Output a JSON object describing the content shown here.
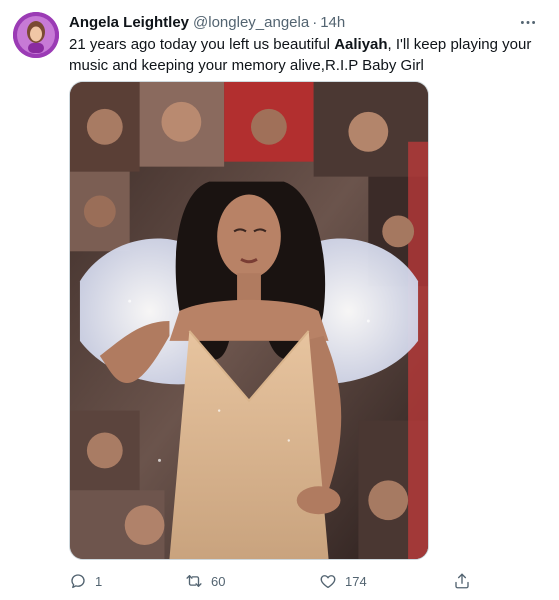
{
  "tweet": {
    "author": {
      "display_name": "Angela Leightley",
      "handle": "@longley_angela",
      "separator": "·",
      "time": "14h",
      "avatar_icon": "user-avatar"
    },
    "text": {
      "before": "21 years ago today you left us beautiful ",
      "bold": "Aaliyah",
      "after": ", I'll keep playing your music and keeping your memory alive,R.I.P Baby Girl"
    },
    "media": {
      "type": "image",
      "description_icon": "photo-collage"
    },
    "more_icon": "more-horizontal-icon",
    "actions": {
      "reply_count": "1",
      "retweet_count": "60",
      "like_count": "174",
      "reply_icon": "reply-icon",
      "retweet_icon": "retweet-icon",
      "like_icon": "heart-icon",
      "share_icon": "share-icon"
    },
    "colors": {
      "text_primary": "#0f1419",
      "text_secondary": "#536471",
      "border": "#cfd9de",
      "avatar_bg": "#9b3bb5"
    }
  }
}
